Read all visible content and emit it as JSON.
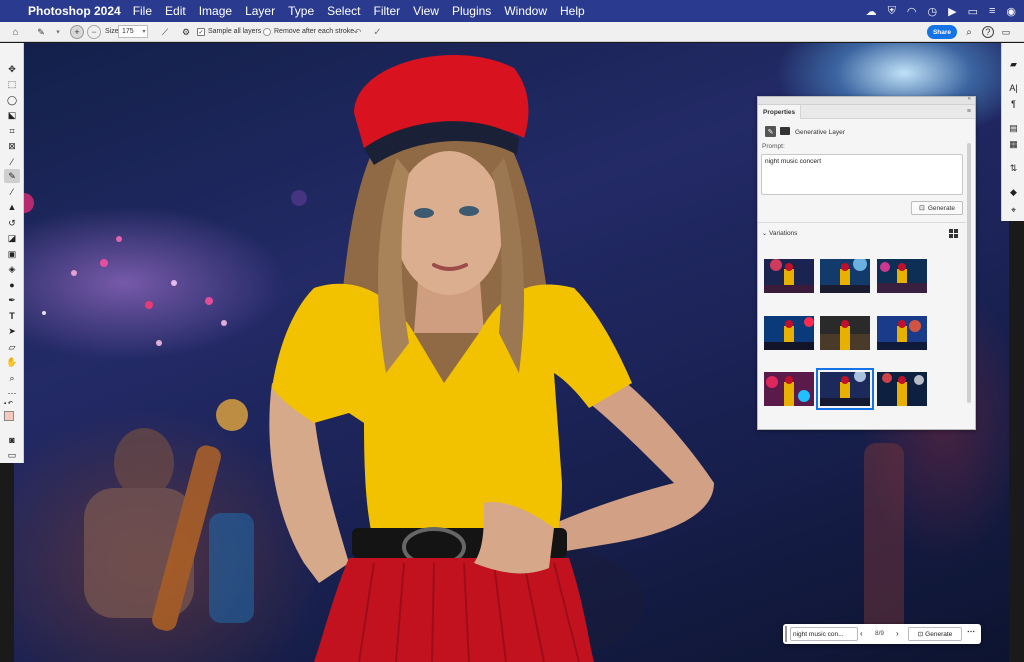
{
  "menubar": {
    "app_name": "Photoshop 2024",
    "menus": [
      "File",
      "Edit",
      "Image",
      "Layer",
      "Type",
      "Select",
      "Filter",
      "View",
      "Plugins",
      "Window",
      "Help"
    ],
    "bg_color": "#2a3b8f"
  },
  "options_bar": {
    "size_label": "Size",
    "size_value": "175",
    "sample_all_layers": "Sample all layers",
    "remove_after_stroke": "Remove after each stroke",
    "share_label": "Share"
  },
  "properties_panel": {
    "tab_label": "Properties",
    "layer_label": "Generative Layer",
    "prompt_label": "Prompt:",
    "prompt_value": "night music concert",
    "generate_label": "Generate",
    "variations_label": "Variations",
    "selected_variation_index": 7
  },
  "contextual_bar": {
    "prompt_preview": "night music con...",
    "counter": "8/9",
    "generate_label": "Generate"
  },
  "colors": {
    "accent": "#1473e6",
    "foreground_swatch": "#f7c8be",
    "shirt": "#f2c200",
    "hat": "#d8121f"
  }
}
